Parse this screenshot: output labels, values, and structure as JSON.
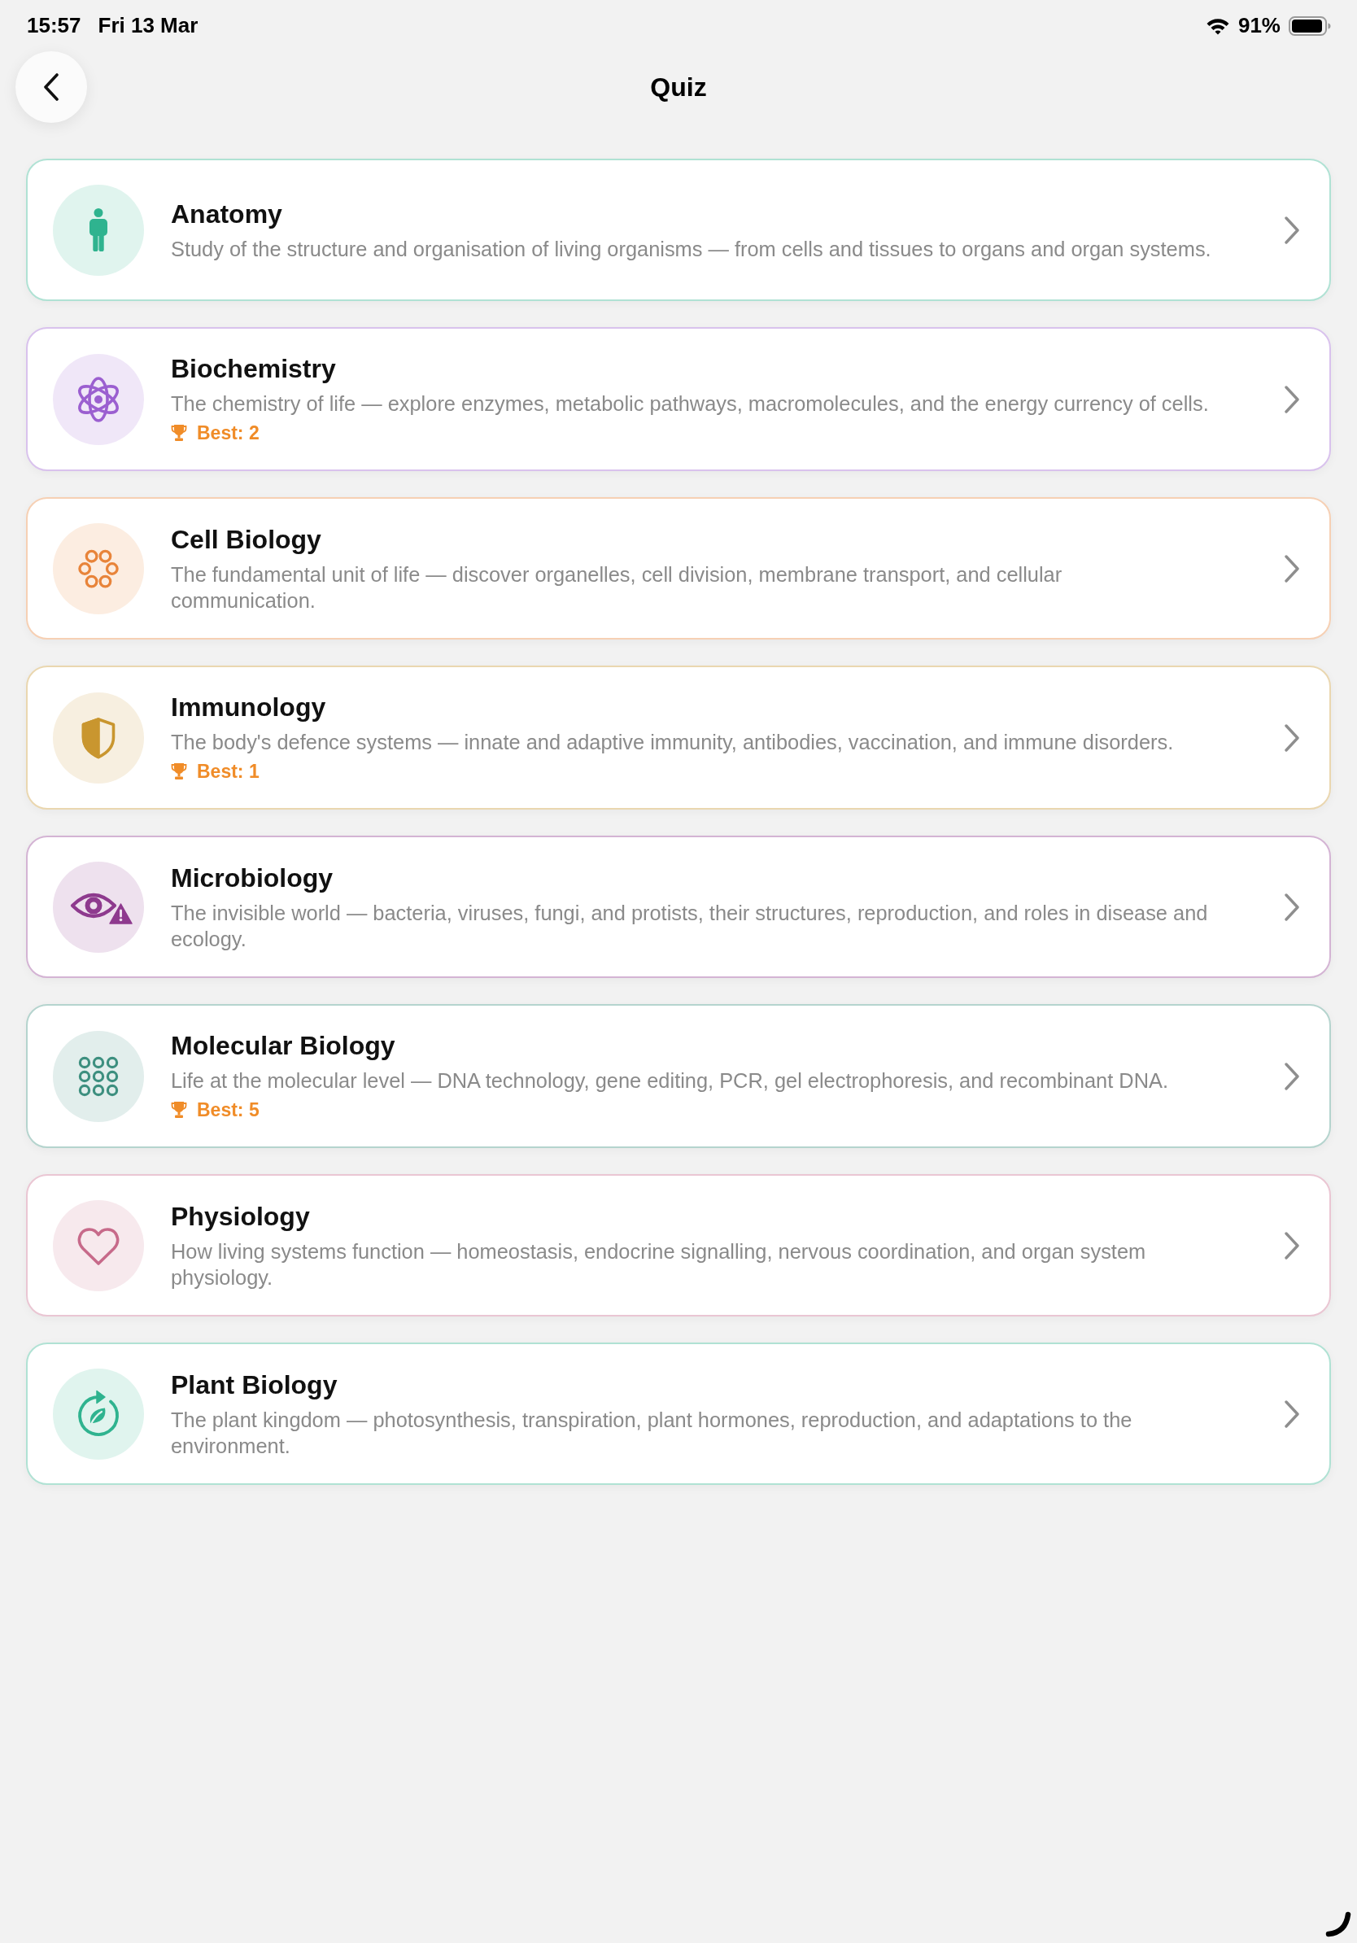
{
  "status_bar": {
    "time": "15:57",
    "date": "Fri 13 Mar",
    "battery": "91%"
  },
  "header": {
    "title": "Quiz"
  },
  "topics": [
    {
      "title": "Anatomy",
      "description": "Study of the structure and organisation of living organisms — from cells and tissues to organs and organ systems.",
      "color": "#2fb38f"
    },
    {
      "title": "Biochemistry",
      "description": "The chemistry of life — explore enzymes, metabolic pathways, macromolecules, and the energy currency of cells.",
      "best": "Best: 2",
      "color": "#9b5fd0"
    },
    {
      "title": "Cell Biology",
      "description": "The fundamental unit of life — discover organelles, cell division, membrane transport, and cellular communication.",
      "color": "#e8843a"
    },
    {
      "title": "Immunology",
      "description": "The body's defence systems — innate and adaptive immunity, antibodies, vaccination, and immune disorders.",
      "best": "Best: 1",
      "color": "#c9962f"
    },
    {
      "title": "Microbiology",
      "description": "The invisible world — bacteria, viruses, fungi, and protists, their structures, reproduction, and roles in disease and ecology.",
      "color": "#8e3a8e"
    },
    {
      "title": "Molecular Biology",
      "description": "Life at the molecular level — DNA technology, gene editing, PCR, gel electrophoresis, and recombinant DNA.",
      "best": "Best: 5",
      "color": "#3d8f7f"
    },
    {
      "title": "Physiology",
      "description": "How living systems function — homeostasis, endocrine signalling, nervous coordination, and organ system physiology.",
      "color": "#c76a8a"
    },
    {
      "title": "Plant Biology",
      "description": "The plant kingdom — photosynthesis, transpiration, plant hormones, reproduction, and adaptations to the environment.",
      "color": "#2fb38f"
    }
  ]
}
